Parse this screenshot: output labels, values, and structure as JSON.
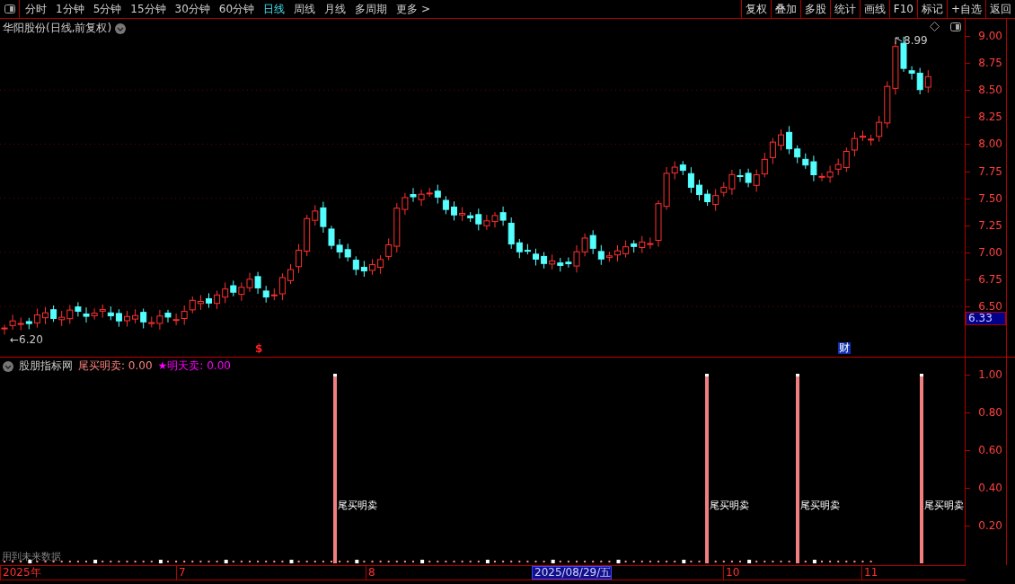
{
  "toolbar": {
    "periods": [
      {
        "label": "分时",
        "selected": false
      },
      {
        "label": "1分钟",
        "selected": false
      },
      {
        "label": "5分钟",
        "selected": false
      },
      {
        "label": "15分钟",
        "selected": false
      },
      {
        "label": "30分钟",
        "selected": false
      },
      {
        "label": "60分钟",
        "selected": false
      },
      {
        "label": "日线",
        "selected": true
      },
      {
        "label": "周线",
        "selected": false
      },
      {
        "label": "月线",
        "selected": false
      },
      {
        "label": "多周期",
        "selected": false
      },
      {
        "label": "更多 >",
        "selected": false
      }
    ],
    "buttons": [
      "复权",
      "叠加",
      "多股",
      "统计",
      "画线",
      "F10",
      "标记",
      "+自选",
      "返回"
    ]
  },
  "main_chart": {
    "title": "华阳股份(日线,前复权)",
    "price_ticks": [
      "9.00",
      "8.75",
      "8.50",
      "8.25",
      "8.00",
      "7.75",
      "7.50",
      "7.25",
      "7.00",
      "6.75",
      "6.50"
    ],
    "current_price": "6.33",
    "low_marker": "←6.20",
    "high_marker": "8.99",
    "event_markers": [
      {
        "label": "$",
        "kind": "dollar"
      },
      {
        "label": "财",
        "kind": "finance"
      }
    ]
  },
  "indicator": {
    "name": "股朋指标网",
    "values": [
      {
        "label": "尾买明卖: 0.00",
        "color": "#ff8080"
      },
      {
        "label": "★明天卖: 0.00",
        "color": "#ff00ff"
      }
    ],
    "ticks": [
      "1.00",
      "0.80",
      "0.60",
      "0.40",
      "0.20"
    ],
    "signals": [
      "尾买明卖",
      "尾买明卖",
      "尾买明卖",
      "尾买明卖"
    ],
    "note": "用到未来数据"
  },
  "date_axis": [
    {
      "label": "2025年",
      "selected": false
    },
    {
      "label": "7",
      "selected": false
    },
    {
      "label": "8",
      "selected": false
    },
    {
      "label": "2025/08/29/五",
      "selected": true
    },
    {
      "label": "10",
      "selected": false
    },
    {
      "label": "11",
      "selected": false
    }
  ]
}
